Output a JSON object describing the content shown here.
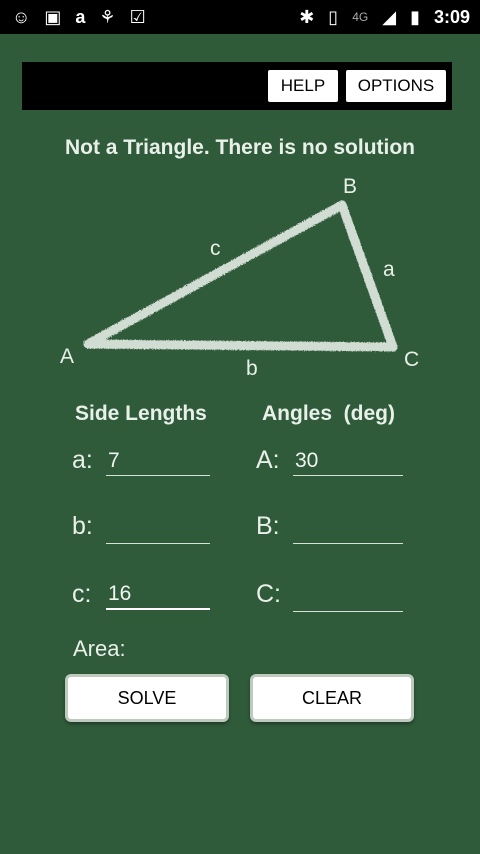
{
  "statusbar": {
    "time": "3:09",
    "left_icons": [
      "snapchat-icon",
      "image-icon",
      "amazon-icon",
      "android-icon",
      "clipboard-check-icon"
    ],
    "right_icons": [
      "bluetooth-icon",
      "vibrate-icon",
      "4g-icon",
      "signal-icon",
      "battery-icon"
    ],
    "network": "4G"
  },
  "toolbar": {
    "help_label": "HELP",
    "options_label": "OPTIONS"
  },
  "message": "Not a Triangle. There is no solution",
  "diagram": {
    "vertex_a": "A",
    "vertex_b": "B",
    "vertex_c": "C",
    "side_a": "a",
    "side_b": "b",
    "side_c": "c"
  },
  "columns": {
    "sides_header": "Side Lengths",
    "angles_header": "Angles  (deg)"
  },
  "sides": {
    "a_label": "a:",
    "a_value": "7",
    "b_label": "b:",
    "b_value": "",
    "c_label": "c:",
    "c_value": "16"
  },
  "angles": {
    "A_label": "A:",
    "A_value": "30",
    "B_label": "B:",
    "B_value": "",
    "C_label": "C:",
    "C_value": ""
  },
  "area_label": "Area:",
  "buttons": {
    "solve_label": "SOLVE",
    "clear_label": "CLEAR"
  },
  "colors": {
    "background": "#2f5b3a",
    "chalk": "#e9efe9",
    "bar": "#000000"
  }
}
